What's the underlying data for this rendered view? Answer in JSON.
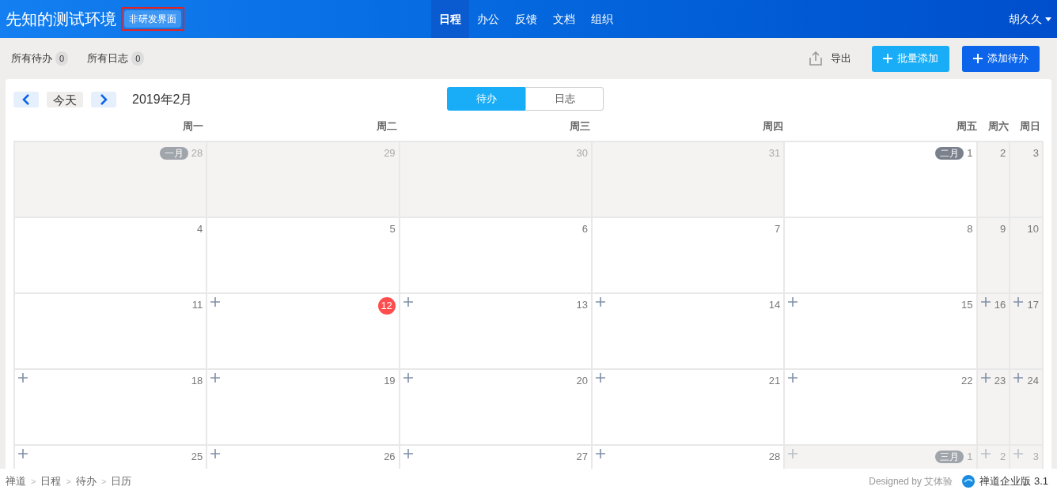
{
  "header": {
    "title": "先知的测试环境",
    "badge": "非研发界面",
    "nav": [
      {
        "label": "日程",
        "selected": true
      },
      {
        "label": "办公",
        "selected": false
      },
      {
        "label": "反馈",
        "selected": false
      },
      {
        "label": "文档",
        "selected": false
      },
      {
        "label": "组织",
        "selected": false
      }
    ],
    "user": "胡久久"
  },
  "toolbar": {
    "filters": [
      {
        "label": "所有待办",
        "count": "0"
      },
      {
        "label": "所有日志",
        "count": "0"
      }
    ],
    "export": "导出",
    "buttons": [
      {
        "label": "批量添加",
        "kind": "secondary"
      },
      {
        "label": "添加待办",
        "kind": "primary"
      }
    ]
  },
  "calendar": {
    "today_button": "今天",
    "month": "2019年2月",
    "views": [
      {
        "label": "待办",
        "selected": true
      },
      {
        "label": "日志",
        "selected": false
      }
    ],
    "weekdays": [
      "周一",
      "周二",
      "周三",
      "周四",
      "周五",
      "周六",
      "周日"
    ],
    "weeks": [
      [
        {
          "day": "28",
          "month_tag": "一月",
          "outside": true,
          "today": false,
          "add": false
        },
        {
          "day": "29",
          "outside": true,
          "today": false,
          "add": false
        },
        {
          "day": "30",
          "outside": true,
          "today": false,
          "add": false
        },
        {
          "day": "31",
          "outside": true,
          "today": false,
          "add": false
        },
        {
          "day": "1",
          "month_tag": "二月",
          "outside": false,
          "today": false,
          "add": false
        },
        {
          "day": "2",
          "outside": false,
          "today": false,
          "add": false
        },
        {
          "day": "3",
          "outside": false,
          "today": false,
          "add": false
        }
      ],
      [
        {
          "day": "4",
          "outside": false,
          "today": false,
          "add": false
        },
        {
          "day": "5",
          "outside": false,
          "today": false,
          "add": false
        },
        {
          "day": "6",
          "outside": false,
          "today": false,
          "add": false
        },
        {
          "day": "7",
          "outside": false,
          "today": false,
          "add": false
        },
        {
          "day": "8",
          "outside": false,
          "today": false,
          "add": false
        },
        {
          "day": "9",
          "outside": false,
          "today": false,
          "add": false
        },
        {
          "day": "10",
          "outside": false,
          "today": false,
          "add": false
        }
      ],
      [
        {
          "day": "11",
          "outside": false,
          "today": false,
          "add": false
        },
        {
          "day": "12",
          "outside": false,
          "today": true,
          "add": true
        },
        {
          "day": "13",
          "outside": false,
          "today": false,
          "add": true
        },
        {
          "day": "14",
          "outside": false,
          "today": false,
          "add": true
        },
        {
          "day": "15",
          "outside": false,
          "today": false,
          "add": true
        },
        {
          "day": "16",
          "outside": false,
          "today": false,
          "add": true
        },
        {
          "day": "17",
          "outside": false,
          "today": false,
          "add": true
        }
      ],
      [
        {
          "day": "18",
          "outside": false,
          "today": false,
          "add": true
        },
        {
          "day": "19",
          "outside": false,
          "today": false,
          "add": true
        },
        {
          "day": "20",
          "outside": false,
          "today": false,
          "add": true
        },
        {
          "day": "21",
          "outside": false,
          "today": false,
          "add": true
        },
        {
          "day": "22",
          "outside": false,
          "today": false,
          "add": true
        },
        {
          "day": "23",
          "outside": false,
          "today": false,
          "add": true
        },
        {
          "day": "24",
          "outside": false,
          "today": false,
          "add": true
        }
      ],
      [
        {
          "day": "25",
          "outside": false,
          "today": false,
          "add": true
        },
        {
          "day": "26",
          "outside": false,
          "today": false,
          "add": true
        },
        {
          "day": "27",
          "outside": false,
          "today": false,
          "add": true
        },
        {
          "day": "28",
          "outside": false,
          "today": false,
          "add": true
        },
        {
          "day": "1",
          "month_tag": "三月",
          "outside": true,
          "today": false,
          "add": true
        },
        {
          "day": "2",
          "outside": true,
          "today": false,
          "add": true
        },
        {
          "day": "3",
          "outside": true,
          "today": false,
          "add": true
        }
      ]
    ]
  },
  "footer": {
    "breadcrumb": [
      "禅道",
      "日程",
      "待办",
      "日历"
    ],
    "separator": ">",
    "designed_by": "Designed by",
    "designer": "艾体验",
    "product": "禅道企业版 3.1"
  }
}
